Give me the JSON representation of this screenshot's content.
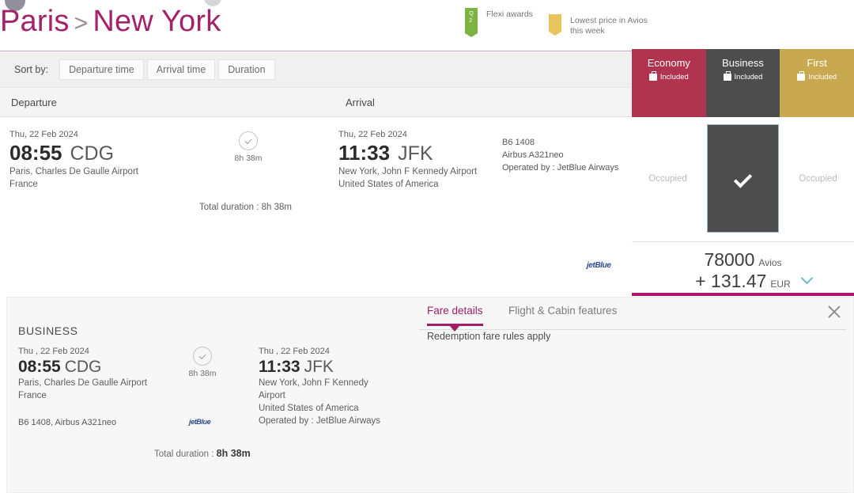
{
  "header": {
    "origin": "Paris",
    "arrow": ">",
    "destination": "New York",
    "legend": [
      {
        "icon": "green-ribbon-icon",
        "label": "Flexi awards",
        "color": "#7cb342"
      },
      {
        "icon": "gold-ribbon-icon",
        "label": "Lowest price in Avios\nthis week",
        "color": "#e8c55c"
      }
    ]
  },
  "sort": {
    "label": "Sort by:",
    "options": [
      "Departure time",
      "Arrival time",
      "Duration"
    ]
  },
  "columns": {
    "departure": "Departure",
    "arrival": "Arrival"
  },
  "cabins": [
    {
      "name": "Economy",
      "baggage": "Included",
      "color": "#b03350"
    },
    {
      "name": "Business",
      "baggage": "Included",
      "color": "#4d4d4d"
    },
    {
      "name": "First",
      "baggage": "Included",
      "color": "#c9a94f"
    }
  ],
  "flight": {
    "departure": {
      "date": "Thu, 22 Feb 2024",
      "time": "08:55",
      "code": "CDG",
      "airport": "Paris, Charles De Gaulle Airport",
      "country": "France"
    },
    "arrival": {
      "date": "Thu, 22 Feb 2024",
      "time": "11:33",
      "code": "JFK",
      "airport": "New York, John F Kennedy Airport",
      "country": "United States of America"
    },
    "duration": "8h 38m",
    "total_duration_label": "Total duration : 8h 38m",
    "flight_number": "B6 1408",
    "aircraft": "Airbus A321neo",
    "operated_by": "Operated by : JetBlue Airways",
    "carrier_logo": "jetBlue"
  },
  "fares": {
    "economy_status": "Occupied",
    "business_selected": true,
    "first_status": "Occupied",
    "avios": "78000",
    "avios_unit": "Avios",
    "cash": "+ 131.47",
    "cash_unit": "EUR"
  },
  "detail": {
    "tab_active": "Fare details",
    "tab_inactive": "Flight & Cabin features",
    "rules": "Redemption fare rules apply",
    "cabin": "BUSINESS",
    "departure": {
      "date": "Thu , 22 Feb 2024",
      "time": "08:55",
      "code": "CDG",
      "airport": "Paris, Charles De Gaulle Airport",
      "country": "France"
    },
    "arrival": {
      "date": "Thu , 22 Feb 2024",
      "time": "11:33",
      "code": "JFK",
      "airport_line1": "New York, John F Kennedy",
      "airport_line2": "Airport",
      "country": "United States of America",
      "operated_by": "Operated by : JetBlue Airways"
    },
    "duration": "8h 38m",
    "total_duration_label": "Total duration :",
    "total_duration_value": "8h 38m",
    "flight_info": "B6 1408, Airbus A321neo",
    "carrier_logo": "jetBlue"
  }
}
